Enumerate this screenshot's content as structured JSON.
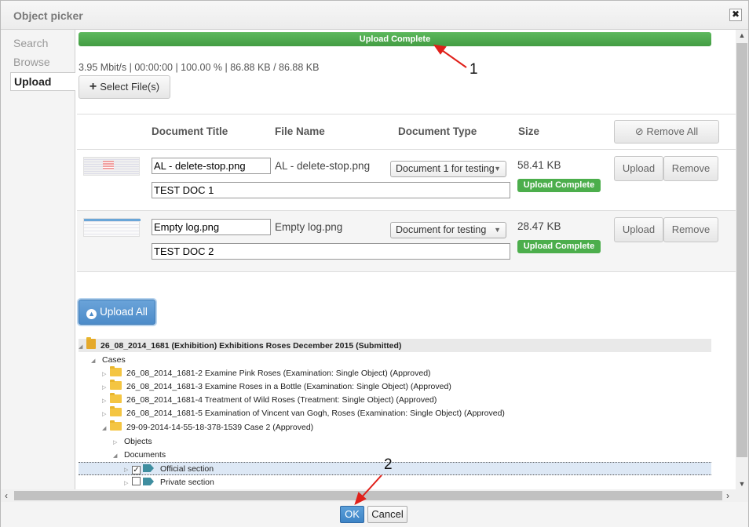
{
  "dialog": {
    "title": "Object picker",
    "close_label": "✖"
  },
  "sidenav": {
    "items": [
      {
        "label": "Search",
        "active": false
      },
      {
        "label": "Browse",
        "active": false
      },
      {
        "label": "Upload",
        "active": true
      }
    ]
  },
  "upload": {
    "progress_label": "Upload Complete",
    "progress_percent": 100,
    "stats": "3.95 Mbit/s | 00:00:00 | 100.00 % | 86.88 KB / 86.88 KB",
    "select_files_label": "Select File(s)",
    "columns": [
      "Document Title",
      "File Name",
      "Document Type",
      "Size"
    ],
    "remove_all_label": "Remove All",
    "files": [
      {
        "title": "AL - delete-stop.png",
        "description": "TEST DOC 1",
        "file_name": "AL - delete-stop.png",
        "document_type": "Document 1 for testing",
        "size": "58.41 KB",
        "status": "Upload Complete",
        "upload_label": "Upload",
        "remove_label": "Remove"
      },
      {
        "title": "Empty log.png",
        "description": "TEST DOC 2",
        "file_name": "Empty log.png",
        "document_type": "Document for testing",
        "size": "28.47 KB",
        "status": "Upload Complete",
        "upload_label": "Upload",
        "remove_label": "Remove"
      }
    ],
    "upload_all_label": "Upload All"
  },
  "tree": {
    "root": "26_08_2014_1681 (Exhibition) Exhibitions Roses December 2015 (Submitted)",
    "cases_label": "Cases",
    "cases": [
      "26_08_2014_1681-2 Examine Pink Roses (Examination: Single Object) (Approved)",
      "26_08_2014_1681-3 Examine Roses in a Bottle (Examination: Single Object) (Approved)",
      "26_08_2014_1681-4 Treatment of Wild Roses (Treatment: Single Object) (Approved)",
      "26_08_2014_1681-5 Examination of Vincent van Gogh, Roses (Examination: Single Object) (Approved)",
      "29-09-2014-14-55-18-378-1539 Case 2 (Approved)"
    ],
    "objects_label": "Objects",
    "documents_label": "Documents",
    "sections": [
      {
        "label": "Official section",
        "checked": true
      },
      {
        "label": "Private section",
        "checked": false
      }
    ]
  },
  "footer": {
    "ok_label": "OK",
    "cancel_label": "Cancel"
  },
  "annotations": {
    "one": "1",
    "two": "2"
  },
  "colors": {
    "success_green": "#4cae4c",
    "primary_blue": "#4d8cc9",
    "annotation_red": "#e0201a"
  }
}
